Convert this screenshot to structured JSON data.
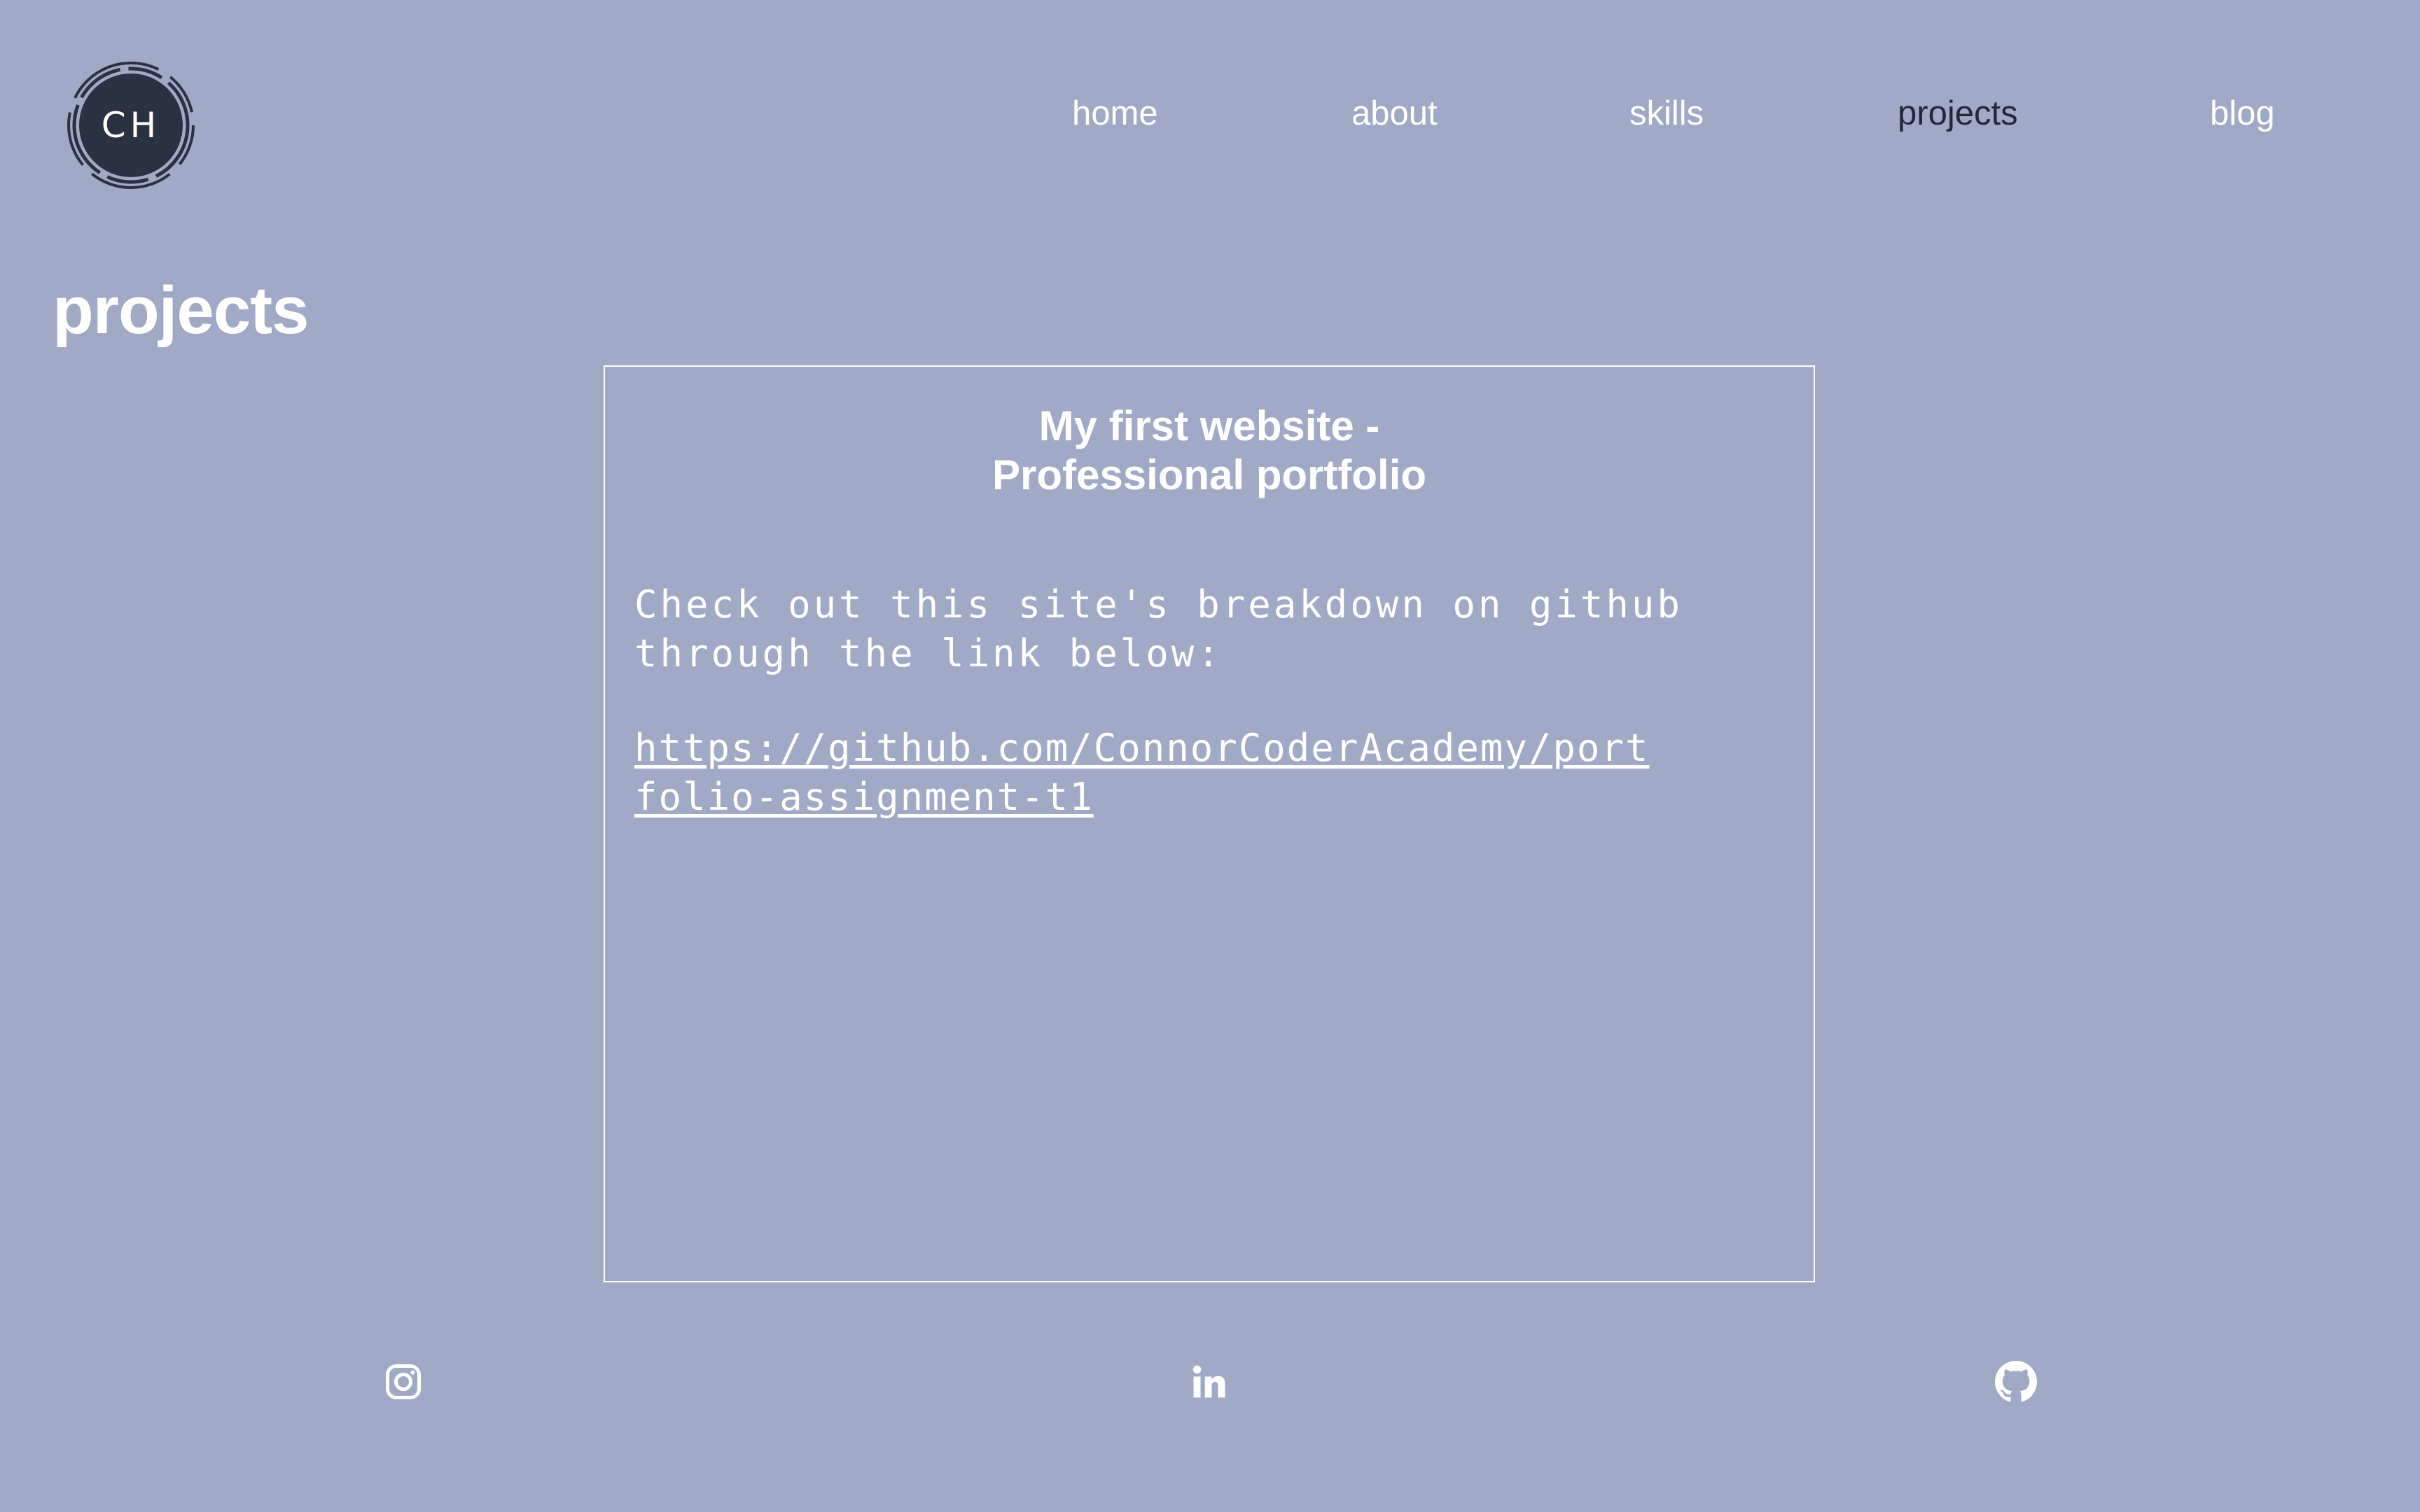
{
  "logo": {
    "initials": "CH",
    "icon": "ch-logo-icon"
  },
  "nav": {
    "items": [
      {
        "label": "home",
        "active": false
      },
      {
        "label": "about",
        "active": false
      },
      {
        "label": "skills",
        "active": false
      },
      {
        "label": "projects",
        "active": true
      },
      {
        "label": "blog",
        "active": false
      }
    ]
  },
  "page": {
    "title": "projects"
  },
  "project": {
    "title_line1": "My first website -",
    "title_line2": "Professional portfolio",
    "description_line1": "Check out this site's breakdown on github",
    "description_line2": "through the link below:",
    "link_line1": "https://github.com/ConnorCoderAcademy/port",
    "link_line2": "folio-assignment-t1"
  },
  "social": [
    {
      "icon": "instagram-icon"
    },
    {
      "icon": "linkedin-icon"
    },
    {
      "icon": "github-icon"
    }
  ],
  "colors": {
    "background": "#a0aac6",
    "text": "#ffffff",
    "active_nav": "#22283a",
    "logo_fill": "#2a3142"
  }
}
